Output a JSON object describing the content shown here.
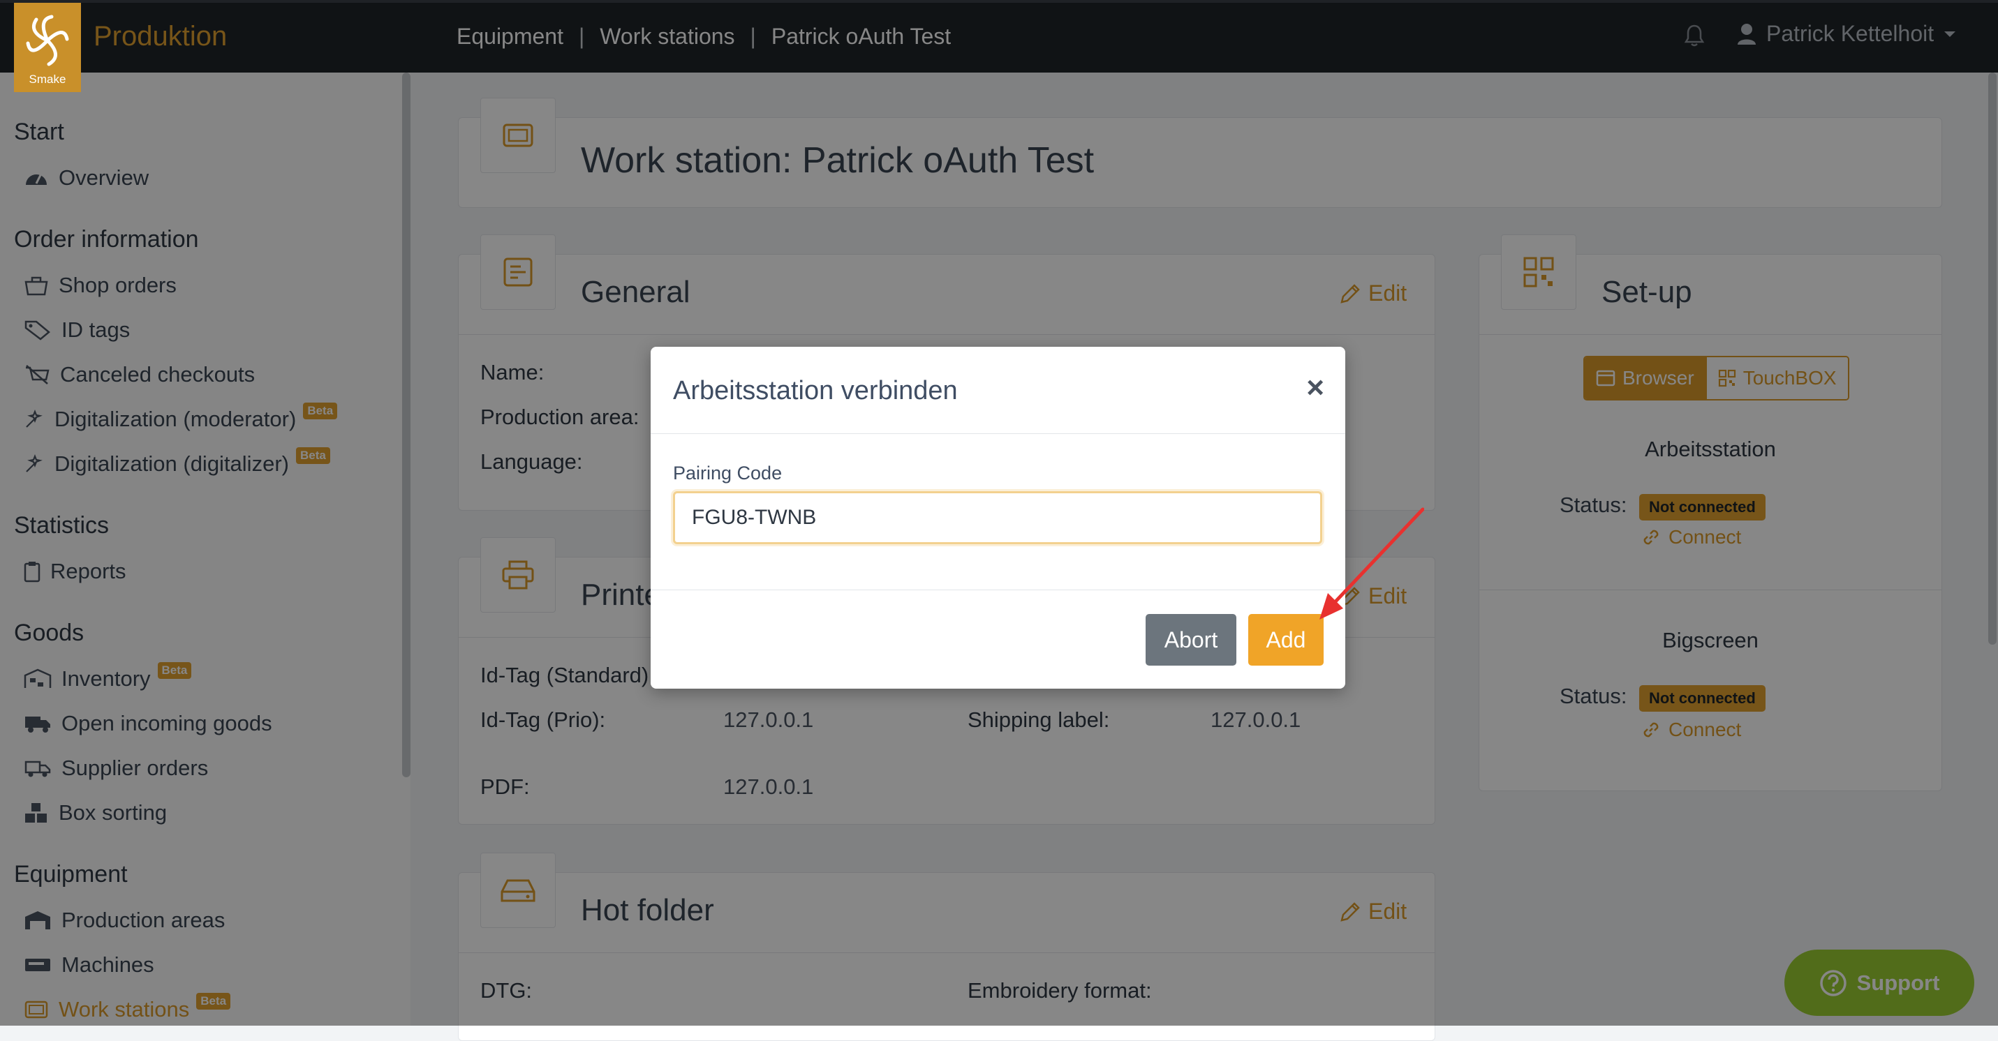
{
  "app": {
    "logo_text": "Smake",
    "title": "Produktion"
  },
  "breadcrumbs": [
    "Equipment",
    "Work stations",
    "Patrick oAuth Test"
  ],
  "breadcrumb_sep": "|",
  "user": {
    "name": "Patrick Kettelhoit"
  },
  "sidebar": {
    "sections": [
      {
        "title": "Start",
        "items": [
          {
            "label": "Overview",
            "icon": "dashboard-icon"
          }
        ]
      },
      {
        "title": "Order information",
        "items": [
          {
            "label": "Shop orders",
            "icon": "shop-icon"
          },
          {
            "label": "ID tags",
            "icon": "tag-icon"
          },
          {
            "label": "Canceled checkouts",
            "icon": "cancel-cart-icon"
          },
          {
            "label": "Digitalization (moderator)",
            "icon": "magic-icon",
            "badge": "Beta"
          },
          {
            "label": "Digitalization (digitalizer)",
            "icon": "magic-icon",
            "badge": "Beta"
          }
        ]
      },
      {
        "title": "Statistics",
        "items": [
          {
            "label": "Reports",
            "icon": "clipboard-icon"
          }
        ]
      },
      {
        "title": "Goods",
        "items": [
          {
            "label": "Inventory",
            "icon": "warehouse-icon",
            "badge": "Beta"
          },
          {
            "label": "Open incoming goods",
            "icon": "truck-icon"
          },
          {
            "label": "Supplier orders",
            "icon": "truck-loading-icon"
          },
          {
            "label": "Box sorting",
            "icon": "boxes-icon"
          }
        ]
      },
      {
        "title": "Equipment",
        "items": [
          {
            "label": "Production areas",
            "icon": "factory-icon"
          },
          {
            "label": "Machines",
            "icon": "machine-icon"
          },
          {
            "label": "Work stations",
            "icon": "workstation-icon",
            "badge": "Beta",
            "active": true
          }
        ]
      }
    ]
  },
  "page": {
    "title": "Work station: Patrick oAuth Test"
  },
  "general": {
    "title": "General",
    "edit": "Edit",
    "fields": [
      {
        "label": "Name:"
      },
      {
        "label": "Production area:"
      },
      {
        "label": "Language:"
      }
    ]
  },
  "printer": {
    "title": "Printer",
    "edit": "Edit",
    "rows": [
      {
        "label": "Id-Tag (Standard):",
        "value": ""
      },
      {
        "label": "Id-Tag (Prio):",
        "value": "127.0.0.1",
        "label2": "Shipping label:",
        "value2": "127.0.0.1"
      },
      {
        "label": "PDF:",
        "value": "127.0.0.1"
      }
    ]
  },
  "hotfolder": {
    "title": "Hot folder",
    "edit": "Edit",
    "label_dtg": "DTG:",
    "label_embroidery": "Embroidery format:"
  },
  "setup": {
    "title": "Set-up",
    "toggle": {
      "browser": "Browser",
      "touchbox": "TouchBOX",
      "selected": "Browser"
    },
    "arbeitsstation": {
      "title": "Arbeitsstation",
      "status_label": "Status:",
      "status": "Not connected",
      "connect": "Connect"
    },
    "bigscreen": {
      "title": "Bigscreen",
      "status_label": "Status:",
      "status": "Not connected",
      "connect": "Connect"
    }
  },
  "modal": {
    "title": "Arbeitsstation verbinden",
    "close": "×",
    "field_label": "Pairing Code",
    "field_value": "FGU8-TWNB",
    "abort": "Abort",
    "add": "Add"
  },
  "support": {
    "label": "Support"
  },
  "colors": {
    "accent": "#d99a2b",
    "topbar": "#1f2429",
    "support": "#9acd32",
    "abort": "#6c757d",
    "add": "#f0a428"
  }
}
